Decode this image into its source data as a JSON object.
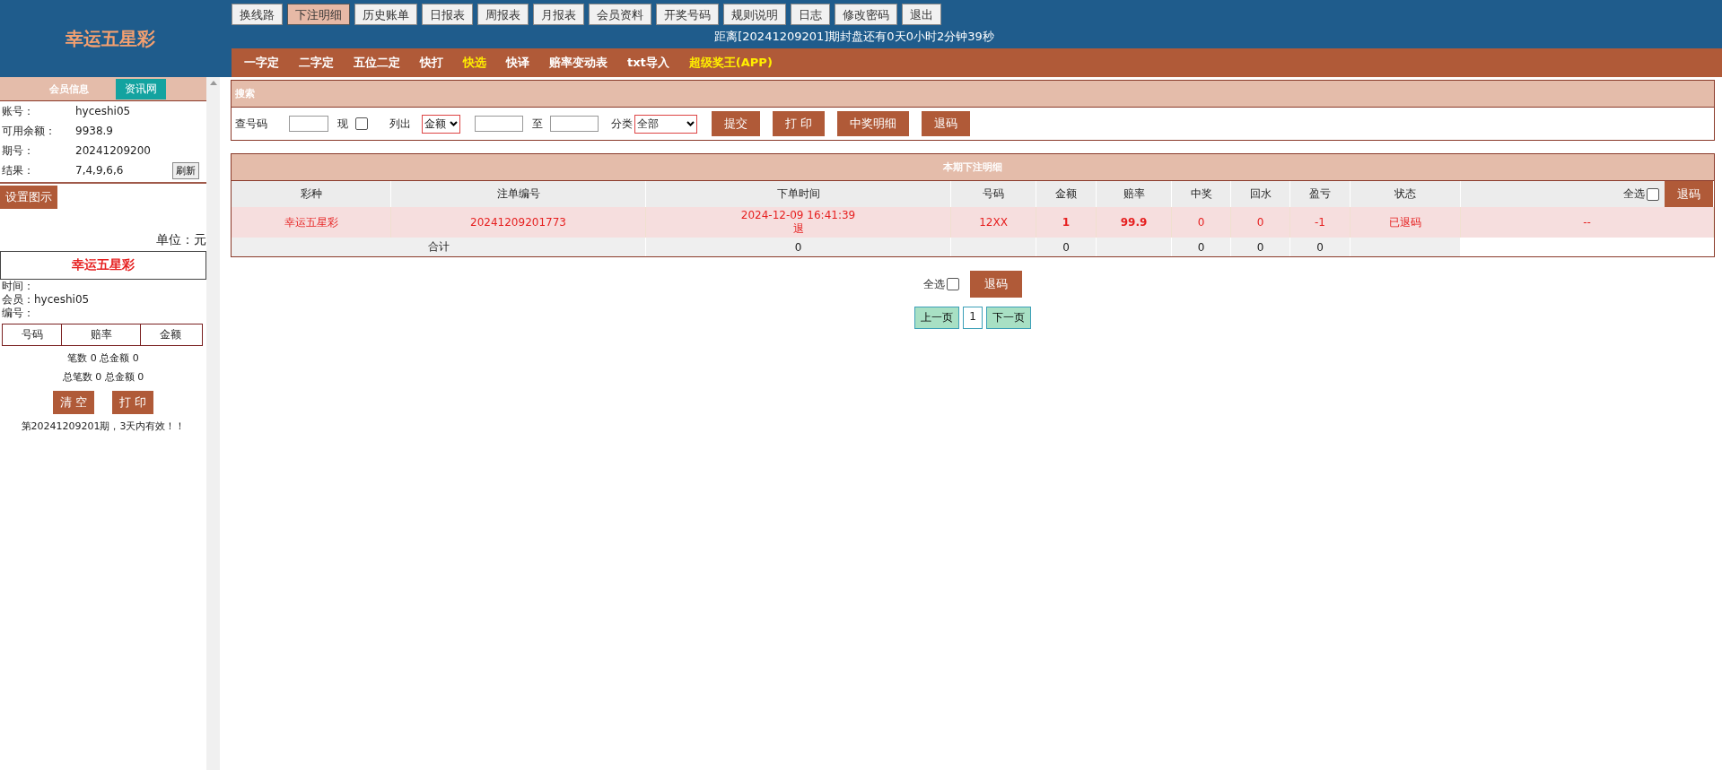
{
  "logo": "幸运五星彩",
  "top_nav": [
    {
      "label": "换线路",
      "selected": false
    },
    {
      "label": "下注明细",
      "selected": true
    },
    {
      "label": "历史账单",
      "selected": false
    },
    {
      "label": "日报表",
      "selected": false
    },
    {
      "label": "周报表",
      "selected": false
    },
    {
      "label": "月报表",
      "selected": false
    },
    {
      "label": "会员资料",
      "selected": false
    },
    {
      "label": "开奖号码",
      "selected": false
    },
    {
      "label": "规则说明",
      "selected": false
    },
    {
      "label": "日志",
      "selected": false
    },
    {
      "label": "修改密码",
      "selected": false
    },
    {
      "label": "退出",
      "selected": false
    }
  ],
  "countdown": "距离[20241209201]期封盘还有0天0小时2分钟39秒",
  "sub_nav": [
    {
      "label": "一字定",
      "color": "#ffffff"
    },
    {
      "label": "二字定",
      "color": "#ffffff"
    },
    {
      "label": "五位二定",
      "color": "#ffffff"
    },
    {
      "label": "快打",
      "color": "#ffffff"
    },
    {
      "label": "快选",
      "color": "#ffee00"
    },
    {
      "label": "快译",
      "color": "#ffffff"
    },
    {
      "label": "赔率变动表",
      "color": "#ffffff"
    },
    {
      "label": "txt导入",
      "color": "#ffffff"
    },
    {
      "label": "超级奖王(APP)",
      "color": "#ffee00"
    }
  ],
  "sidebar": {
    "tabs": [
      {
        "label": "会员信息",
        "selected": true
      },
      {
        "label": "资讯网",
        "selected": false
      }
    ],
    "info": [
      {
        "label": "账号：",
        "value": "hyceshi05"
      },
      {
        "label": "可用余额：",
        "value": "9938.9"
      },
      {
        "label": "期号：",
        "value": "20241209200"
      },
      {
        "label": "结果：",
        "value": "7,4,9,6,6",
        "button": "刷新"
      }
    ],
    "settings_button": "设置图示",
    "unit": "单位：元",
    "ticket": {
      "title": "幸运五星彩",
      "lines": [
        "时间：",
        "会员：hyceshi05",
        "编号："
      ],
      "columns": [
        "号码",
        "赔率",
        "金额"
      ],
      "summary": [
        "笔数 0 总金额 0",
        "总笔数 0 总金额 0"
      ],
      "buttons": [
        "清 空",
        "打 印"
      ],
      "note": "第20241209201期，3天内有效！！"
    }
  },
  "search": {
    "title": "搜索",
    "number_label": "查号码",
    "now_label": "现",
    "now_checked": false,
    "list_label": "列出",
    "list_value": "金额",
    "to_label": "至",
    "category_label": "分类",
    "category_value": "全部",
    "buttons": [
      "提交",
      "打 印",
      "中奖明细",
      "退码"
    ]
  },
  "table": {
    "title": "本期下注明细",
    "columns": [
      "彩种",
      "注单编号",
      "下单时间",
      "号码",
      "金额",
      "赔率",
      "中奖",
      "回水",
      "盈亏",
      "状态"
    ],
    "select_all_label": "全选",
    "select_all_checked": false,
    "cancel_button": "退码",
    "rows": [
      {
        "cells": [
          "幸运五星彩",
          "20241209201773",
          "2024-12-09 16:41:39",
          "12XX",
          "1",
          "99.9",
          "0",
          "0",
          "-1",
          "已退码"
        ],
        "time_note": "退",
        "action": "--"
      }
    ],
    "total": {
      "label": "合计",
      "cells": [
        "0",
        "",
        "0",
        "",
        "0",
        "0",
        "0",
        ""
      ]
    }
  },
  "bottom": {
    "select_all_label": "全选",
    "select_all_checked": false,
    "cancel_button": "退码"
  },
  "pagination": {
    "prev": "上一页",
    "page": "1",
    "next": "下一页"
  }
}
